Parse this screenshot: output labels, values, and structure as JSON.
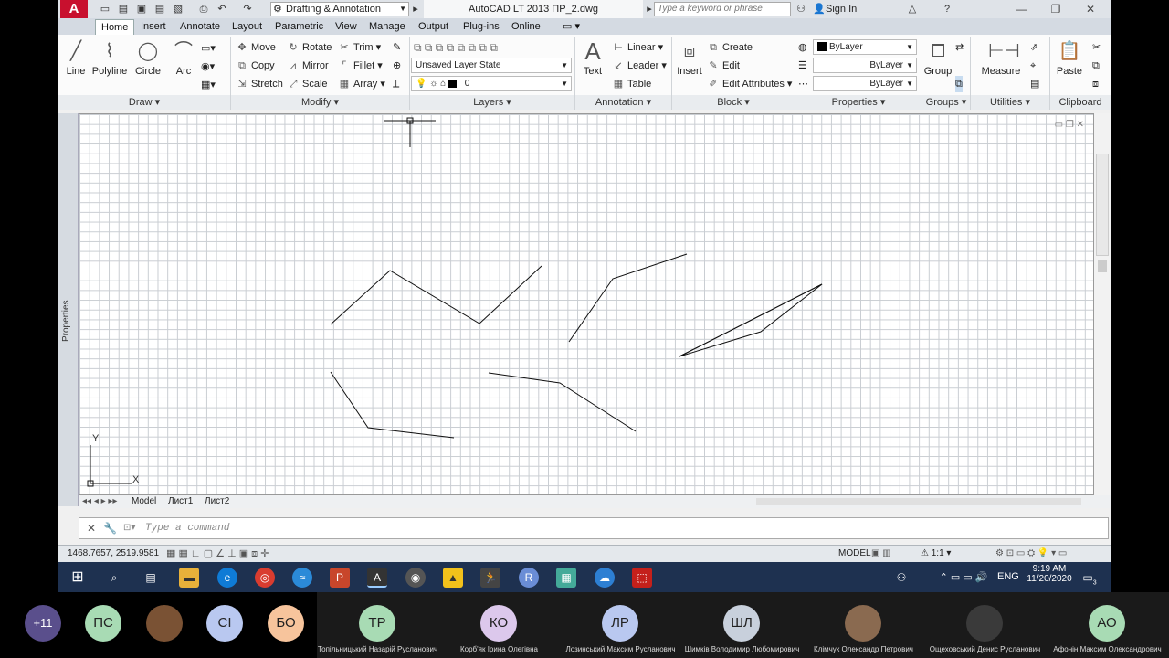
{
  "titlebar": {
    "workspace": "Drafting & Annotation",
    "app_title": "AutoCAD LT 2013   ПР_2.dwg",
    "search_placeholder": "Type a keyword or phrase",
    "sign_in": "Sign In"
  },
  "tabs": [
    "Home",
    "Insert",
    "Annotate",
    "Layout",
    "Parametric",
    "View",
    "Manage",
    "Output",
    "Plug-ins",
    "Online"
  ],
  "draw": {
    "title": "Draw",
    "line": "Line",
    "polyline": "Polyline",
    "circle": "Circle",
    "arc": "Arc"
  },
  "modify": {
    "title": "Modify",
    "move": "Move",
    "rotate": "Rotate",
    "trim": "Trim",
    "copy": "Copy",
    "mirror": "Mirror",
    "fillet": "Fillet",
    "stretch": "Stretch",
    "scale": "Scale",
    "array": "Array"
  },
  "layers": {
    "title": "Layers",
    "layer_state": "Unsaved Layer State",
    "current_layer": "0"
  },
  "annotation": {
    "title": "Annotation",
    "text": "Text",
    "linear": "Linear",
    "leader": "Leader",
    "table": "Table"
  },
  "block": {
    "title": "Block",
    "insert": "Insert",
    "create": "Create",
    "edit": "Edit",
    "edit_attributes": "Edit Attributes"
  },
  "properties": {
    "title": "Properties",
    "color": "ByLayer",
    "linetype": "ByLayer",
    "lineweight": "ByLayer"
  },
  "groups": {
    "title": "Groups",
    "group": "Group"
  },
  "utilities": {
    "title": "Utilities",
    "measure": "Measure"
  },
  "clipboard": {
    "title": "Clipboard",
    "paste": "Paste"
  },
  "side_panel": {
    "properties_label": "Properties"
  },
  "layout_tabs": [
    "Model",
    "Лист1",
    "Лист2"
  ],
  "command": {
    "placeholder": "Type a command"
  },
  "status": {
    "coords": "1468.7657, 2519.9581",
    "model": "MODEL",
    "scale": "1:1"
  },
  "taskbar": {
    "lang": "ENG",
    "time": "9:19 AM",
    "date": "11/20/2020",
    "notif": "3"
  },
  "participants": [
    {
      "initials": "+11",
      "name": "",
      "color": "#5a4f8c"
    },
    {
      "initials": "ПС",
      "name": "",
      "color": "#a8dbb4"
    },
    {
      "initials": "",
      "name": "",
      "color": "#7a5234",
      "photo": true
    },
    {
      "initials": "СІ",
      "name": "",
      "color": "#b9c8f0"
    },
    {
      "initials": "БО",
      "name": "",
      "color": "#f7c49c"
    },
    {
      "initials": "ТР",
      "name": "Топільницький Назарій Русланович",
      "color": "#a8dbb4"
    },
    {
      "initials": "КО",
      "name": "Корб'як Ірина Олегівна",
      "color": "#dcc8ec"
    },
    {
      "initials": "ЛР",
      "name": "Лозинський Максим Русланович",
      "color": "#b9c8f0"
    },
    {
      "initials": "ШЛ",
      "name": "Шимків Володимир Любомирович",
      "color": "#c8d0dc"
    },
    {
      "initials": "",
      "name": "Клімчук Олександр Петрович",
      "color": "#8a6a50",
      "photo": true
    },
    {
      "initials": "",
      "name": "Ощеховський Денис Русланович",
      "color": "#3a3a3a",
      "photo": true
    },
    {
      "initials": "АО",
      "name": "Афонін Максим Олександрович",
      "color": "#a8dbb4"
    }
  ]
}
